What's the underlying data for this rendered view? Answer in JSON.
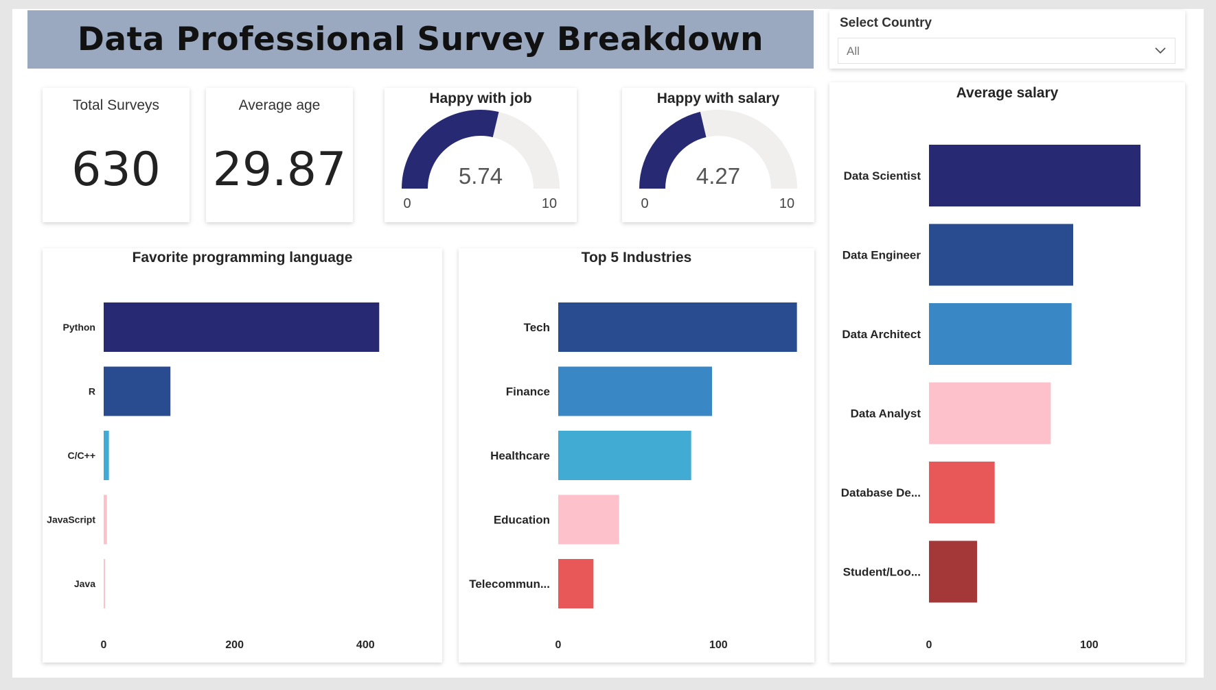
{
  "header": {
    "title": "Data Professional Survey Breakdown"
  },
  "slicer": {
    "label": "Select Country",
    "value": "All",
    "icon": "chevron-down-icon"
  },
  "kpis": {
    "total_surveys": {
      "label": "Total Surveys",
      "value": "630"
    },
    "average_age": {
      "label": "Average age",
      "value": "29.87"
    }
  },
  "gauges": {
    "happy_job": {
      "title": "Happy with job",
      "value": 5.74,
      "value_label": "5.74",
      "min": 0,
      "max": 10,
      "min_label": "0",
      "max_label": "10"
    },
    "happy_salary": {
      "title": "Happy with salary",
      "value": 4.27,
      "value_label": "4.27",
      "min": 0,
      "max": 10,
      "min_label": "0",
      "max_label": "10"
    }
  },
  "colors": {
    "navy": "#272a72",
    "dark_blue": "#294c91",
    "mid_blue": "#3a87c5",
    "light_blue": "#41abd3",
    "pink": "#fcc1ca",
    "coral": "#e85858",
    "dark_red": "#a43838",
    "gauge_track": "#f0efee"
  },
  "chart_data": [
    {
      "id": "languages",
      "type": "bar",
      "orientation": "horizontal",
      "title": "Favorite programming language",
      "categories": [
        "Python",
        "R",
        "C/C++",
        "JavaScript",
        "Java"
      ],
      "values": [
        421,
        102,
        8,
        5,
        2
      ],
      "colors": [
        "#272a72",
        "#294c91",
        "#41abd3",
        "#fcc1ca",
        "#fcc1ca"
      ],
      "xlim": [
        0,
        470
      ],
      "xticks": [
        0,
        200,
        400
      ],
      "xlabel": "",
      "ylabel": ""
    },
    {
      "id": "industries",
      "type": "bar",
      "orientation": "horizontal",
      "title": "Top 5 Industries",
      "categories": [
        "Tech",
        "Finance",
        "Healthcare",
        "Education",
        "Telecommun..."
      ],
      "values": [
        149,
        96,
        83,
        38,
        22
      ],
      "colors": [
        "#294c91",
        "#3a87c5",
        "#41abd3",
        "#fcc1ca",
        "#e85858"
      ],
      "xlim": [
        0,
        150
      ],
      "xticks": [
        0,
        100
      ],
      "xlabel": "",
      "ylabel": ""
    },
    {
      "id": "salary",
      "type": "bar",
      "orientation": "horizontal",
      "title": "Average salary",
      "categories": [
        "Data Scientist",
        "Data Engineer",
        "Data Architect",
        "Data Analyst",
        "Database De...",
        "Student/Loo..."
      ],
      "values": [
        132,
        90,
        89,
        76,
        41,
        30
      ],
      "colors": [
        "#272a72",
        "#294c91",
        "#3a87c5",
        "#fcc1ca",
        "#e85858",
        "#a43838"
      ],
      "xlim": [
        0,
        150
      ],
      "xticks": [
        0,
        100
      ],
      "xlabel": "",
      "ylabel": ""
    }
  ]
}
